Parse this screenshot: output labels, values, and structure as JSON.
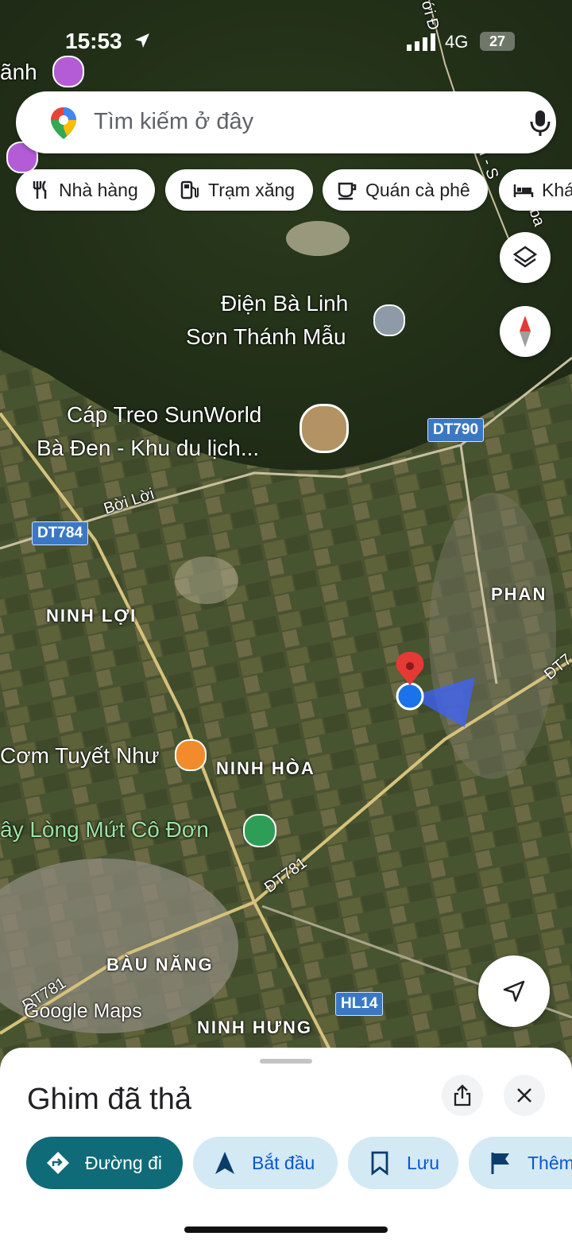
{
  "status": {
    "time": "15:53",
    "network": "4G",
    "battery": "27"
  },
  "search": {
    "placeholder": "Tìm kiếm ở đây"
  },
  "chips": [
    {
      "label": "Nhà hàng",
      "icon": "restaurant-icon"
    },
    {
      "label": "Trạm xăng",
      "icon": "gas-station-icon"
    },
    {
      "label": "Quán cà phê",
      "icon": "coffee-icon"
    },
    {
      "label": "Khá",
      "icon": "hotel-icon"
    }
  ],
  "map": {
    "pois": {
      "top_left": "ãnh",
      "temple_line1": "Điện Bà Linh",
      "temple_line2": "Sơn Thánh Mẫu",
      "cable_line1": "Cáp Treo SunWorld",
      "cable_line2": "Bà Đen - Khu du lịch...",
      "restaurant": "Cơm Tuyết Như",
      "tree": "ây Lòng Mứt Cô Đơn"
    },
    "areas": {
      "ninh_loi": "NINH LỢI",
      "ninh_hoa": "NINH HÒA",
      "phan": "PHAN",
      "bau_nang": "BÀU NĂNG",
      "ninh_hung": "NINH HƯNG"
    },
    "roads": {
      "boi_loi": "Bời Lời",
      "dt781_label": "ĐT781",
      "dt781_left": "ĐT781",
      "top_road": "ới Đ",
      "right_road": "I - S",
      "right_road2": "ba",
      "right_edge": "ĐT7"
    },
    "badges": {
      "dt790": "DT790",
      "dt784": "DT784",
      "hl14": "HL14"
    },
    "watermark": "Google Maps",
    "accent_pin": "#e53935",
    "accent_location": "#1a73e8"
  },
  "sheet": {
    "title": "Ghim đã thả",
    "actions": [
      {
        "label": "Đường đi",
        "icon": "directions-icon"
      },
      {
        "label": "Bắt đầu",
        "icon": "navigation-arrow-icon"
      },
      {
        "label": "Lưu",
        "icon": "bookmark-icon"
      },
      {
        "label": "Thêm",
        "icon": "flag-icon"
      }
    ]
  }
}
